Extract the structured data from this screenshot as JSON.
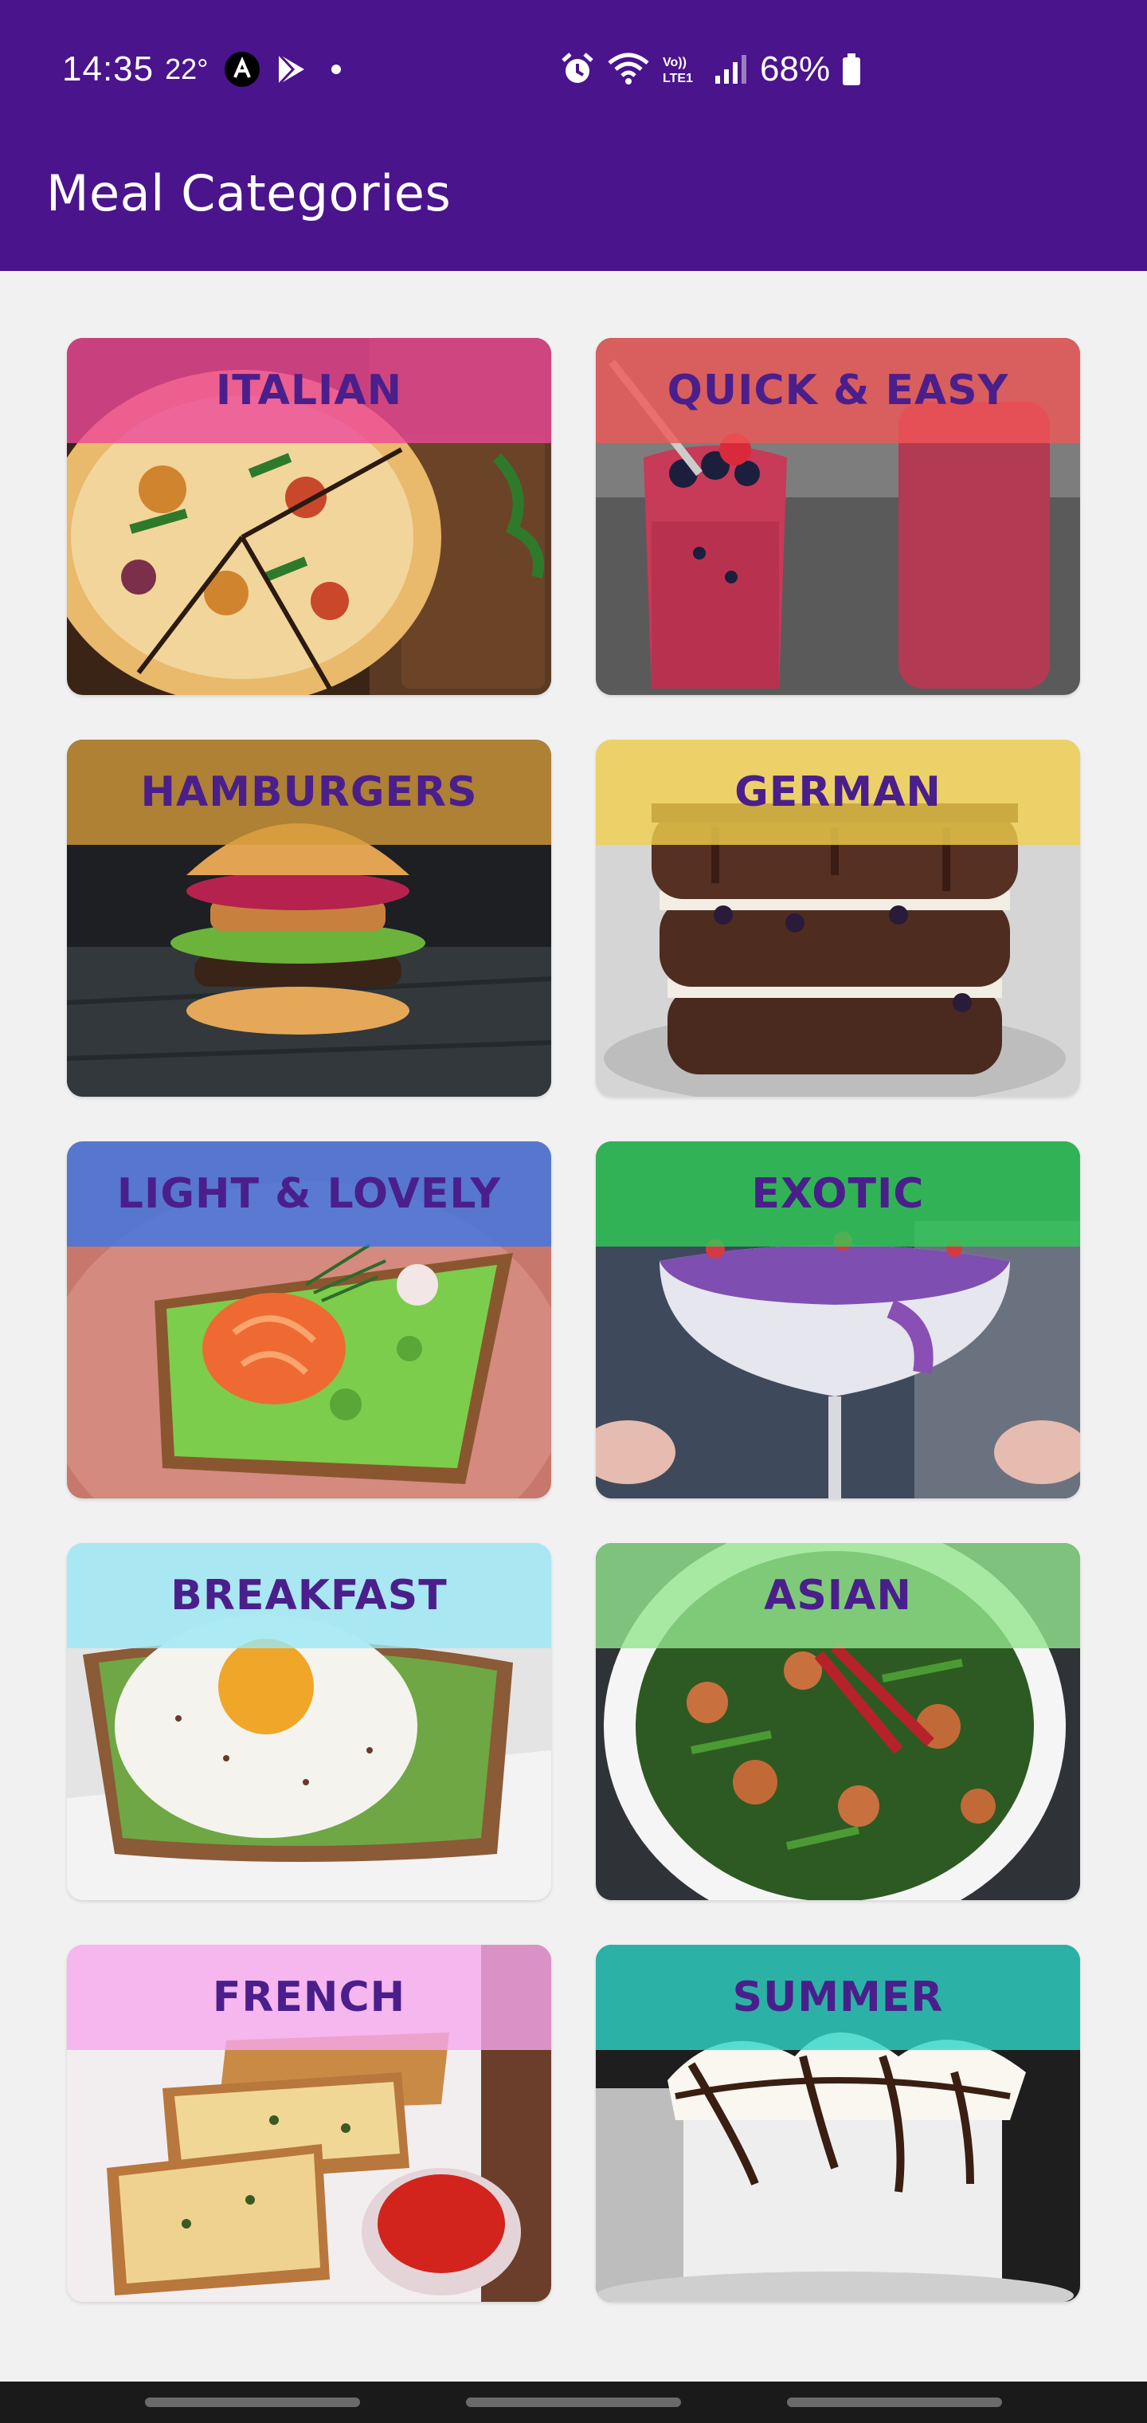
{
  "status_bar": {
    "time": "14:35",
    "temperature": "22°",
    "battery": "68%"
  },
  "app_bar": {
    "title": "Meal Categories",
    "color": "#4a148c"
  },
  "categories": [
    {
      "label": "ITALIAN",
      "band_color": "#ec4899",
      "photo": "pizza"
    },
    {
      "label": "QUICK & EASY",
      "band_color": "#f05656",
      "photo": "berry-smoothie"
    },
    {
      "label": "HAMBURGERS",
      "band_color": "#d39a3a",
      "photo": "burger"
    },
    {
      "label": "GERMAN",
      "band_color": "#f0d04c",
      "photo": "chocolate-layer-cake"
    },
    {
      "label": "LIGHT & LOVELY",
      "band_color": "#3b76e6",
      "photo": "avocado-salmon-toast"
    },
    {
      "label": "EXOTIC",
      "band_color": "#2fcc55",
      "photo": "chia-pudding-glass"
    },
    {
      "label": "BREAKFAST",
      "band_color": "#9ae9f5",
      "photo": "egg-toast"
    },
    {
      "label": "ASIAN",
      "band_color": "#94e68f",
      "photo": "stir-fry-bowl"
    },
    {
      "label": "FRENCH",
      "band_color": "#f6a8ee",
      "photo": "cheese-toast"
    },
    {
      "label": "SUMMER",
      "band_color": "#2fd6c8",
      "photo": "iced-coffee"
    }
  ]
}
